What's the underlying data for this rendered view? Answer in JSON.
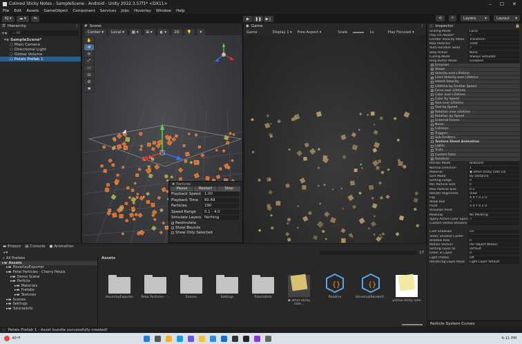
{
  "window": {
    "title": "Colored Sticky Notes - SampleScene - Android - Unity 2022.3.57f1* <DX11>",
    "min": "–",
    "max": "☐",
    "close": "✕"
  },
  "menu": [
    "File",
    "Edit",
    "Assets",
    "GameObject",
    "Component",
    "Services",
    "Jobs",
    "Hoverlay",
    "Window",
    "Help"
  ],
  "toolbar": {
    "account": "KJ ▾",
    "cloud": "☁ ▾",
    "layers": "Layers",
    "layout": "Layout"
  },
  "hierarchy": {
    "tab": "Hierarchy",
    "search_placeholder": "All",
    "items": [
      {
        "label": "SampleScene*",
        "indent": 0,
        "bold": true,
        "selected": false
      },
      {
        "label": "Main Camera",
        "indent": 1,
        "bold": false,
        "selected": false
      },
      {
        "label": "Directional Light",
        "indent": 1,
        "bold": false,
        "selected": false
      },
      {
        "label": "Global Volume",
        "indent": 1,
        "bold": false,
        "selected": false
      },
      {
        "label": "Petals Prefab 1",
        "indent": 1,
        "bold": false,
        "selected": true
      }
    ]
  },
  "scene": {
    "tab": "Scene",
    "center": "Center ▾",
    "local": "Local ▾",
    "mode2d": "2D",
    "particles": {
      "title": "Particles",
      "pause": "Pause",
      "restart": "Restart",
      "stop": "Stop",
      "rows": [
        {
          "label": "Playback Speed",
          "value": "1.00"
        },
        {
          "label": "Playback Time",
          "value": "80.69"
        },
        {
          "label": "Particles",
          "value": "190"
        },
        {
          "label": "Speed Range",
          "value": "0.1 - 4.0"
        },
        {
          "label": "Simulate Layers",
          "value": "Nothing"
        }
      ],
      "checks": [
        {
          "label": "Resimulate",
          "checked": true
        },
        {
          "label": "Show Bounds",
          "checked": false
        },
        {
          "label": "Show Only Selected",
          "checked": false
        }
      ]
    }
  },
  "game": {
    "tab": "Game",
    "mode": "Game",
    "display": "Display 1 ▾",
    "aspect": "Free Aspect ▾",
    "scale": "Scale",
    "scale_value": "1x",
    "play_focused": "Play Focused ▾"
  },
  "inspector": {
    "tab": "Inspector",
    "properties": [
      {
        "label": "Scaling Mode",
        "value": "Local"
      },
      {
        "label": "Play On Awake*",
        "value": "✓"
      },
      {
        "label": "Emitter Velocity Mode",
        "value": "Transform"
      },
      {
        "label": "Max Particles",
        "value": "1000"
      },
      {
        "label": "Auto Random Seed",
        "value": "✓"
      },
      {
        "label": "Stop Action",
        "value": "None"
      },
      {
        "label": "Culling Mode",
        "value": "Always Simulate"
      },
      {
        "label": "Ring Buffer Mode",
        "value": "Disabled"
      }
    ],
    "modules": [
      {
        "label": "Emission",
        "checked": true,
        "bold": false
      },
      {
        "label": "Shape",
        "checked": true,
        "bold": false
      },
      {
        "label": "Velocity over Lifetime",
        "checked": false,
        "bold": false
      },
      {
        "label": "Limit Velocity over Lifetime",
        "checked": true,
        "bold": false
      },
      {
        "label": "Inherit Velocity",
        "checked": false,
        "bold": false
      },
      {
        "label": "Lifetime by Emitter Speed",
        "checked": false,
        "bold": false
      },
      {
        "label": "Force over Lifetime",
        "checked": true,
        "bold": false
      },
      {
        "label": "Color over Lifetime",
        "checked": false,
        "bold": false
      },
      {
        "label": "Color by Speed",
        "checked": false,
        "bold": false
      },
      {
        "label": "Size over Lifetime",
        "checked": true,
        "bold": false
      },
      {
        "label": "Size by Speed",
        "checked": false,
        "bold": false
      },
      {
        "label": "Rotation over Lifetime",
        "checked": true,
        "bold": false
      },
      {
        "label": "Rotation by Speed",
        "checked": false,
        "bold": false
      },
      {
        "label": "External Forces",
        "checked": false,
        "bold": false
      },
      {
        "label": "Noise",
        "checked": false,
        "bold": false
      },
      {
        "label": "Collision",
        "checked": false,
        "bold": false
      },
      {
        "label": "Triggers",
        "checked": false,
        "bold": false
      },
      {
        "label": "Sub Emitters",
        "checked": false,
        "bold": false
      },
      {
        "label": "Texture Sheet Animation",
        "checked": false,
        "bold": true
      },
      {
        "label": "Lights",
        "checked": false,
        "bold": false
      },
      {
        "label": "Trails",
        "checked": false,
        "bold": false
      },
      {
        "label": "Custom Data",
        "checked": false,
        "bold": false
      },
      {
        "label": "Renderer",
        "checked": true,
        "bold": false
      }
    ],
    "renderer": [
      {
        "label": "Render Mode",
        "value": "Billboard"
      },
      {
        "label": "Normal Direction",
        "value": "1"
      },
      {
        "label": "Material",
        "value": "◉ other sticky note col"
      },
      {
        "label": "Sort Mode",
        "value": "By Distance"
      },
      {
        "label": "Sorting Fudge",
        "value": "0"
      },
      {
        "label": "Min Particle Size",
        "value": "0"
      },
      {
        "label": "Max Particle Size",
        "value": "0.5"
      },
      {
        "label": "Render Alignment",
        "value": "View"
      },
      {
        "label": "Flip",
        "value": "X 0   Y 0   Z 0"
      },
      {
        "label": "Allow Roll",
        "value": "✓"
      },
      {
        "label": "Pivot",
        "value": "X 0   Y 0   Z 0"
      },
      {
        "label": "Visualize Pivot",
        "value": ""
      },
      {
        "label": "Masking",
        "value": "No Masking"
      },
      {
        "label": "Apply Active Color Space",
        "value": "✓"
      },
      {
        "label": "Custom Vertex Streams",
        "value": ""
      },
      {
        "label": "",
        "value": ""
      },
      {
        "label": "Cast Shadows",
        "value": "On"
      },
      {
        "label": "Static Shadow Caster",
        "value": ""
      },
      {
        "label": "Shadow Bias",
        "value": "0"
      },
      {
        "label": "Motion Vectors",
        "value": "Per Object Motion"
      },
      {
        "label": "Sorting Layer ID",
        "value": "Default"
      },
      {
        "label": "Order in Layer",
        "value": "0"
      },
      {
        "label": "Light Probes",
        "value": "Off"
      },
      {
        "label": "Rendering Layer Mask",
        "value": "Light Layer default"
      }
    ],
    "curves": "Particle System Curves"
  },
  "project": {
    "tabs": [
      "Project",
      "Console",
      "Animation"
    ],
    "all_prefabs": "All Prefabs",
    "breadcrumb": "Assets",
    "count": "17",
    "tree": [
      {
        "label": "Assets",
        "indent": 0,
        "bold": true
      },
      {
        "label": "HoverlayExporter",
        "indent": 1,
        "bold": false
      },
      {
        "label": "Petal Particles - Cherry Petals",
        "indent": 1,
        "bold": false
      },
      {
        "label": "Demo Scene",
        "indent": 2,
        "bold": false
      },
      {
        "label": "Particle",
        "indent": 2,
        "bold": false
      },
      {
        "label": "Materials",
        "indent": 3,
        "bold": false
      },
      {
        "label": "Prefabs",
        "indent": 3,
        "bold": false
      },
      {
        "label": "Textures",
        "indent": 3,
        "bold": false
      },
      {
        "label": "Scenes",
        "indent": 1,
        "bold": false
      },
      {
        "label": "Settings",
        "indent": 1,
        "bold": false
      },
      {
        "label": "TutorialInfo",
        "indent": 1,
        "bold": false
      }
    ],
    "assets": [
      {
        "label": "HoverlayExporter",
        "kind": "folder"
      },
      {
        "label": "Petal Particles - ...",
        "kind": "folder"
      },
      {
        "label": "Scenes",
        "kind": "folder"
      },
      {
        "label": "Settings",
        "kind": "folder"
      },
      {
        "label": "TutorialInfo",
        "kind": "folder"
      },
      {
        "label": "◉ other sticky note...",
        "kind": "note"
      },
      {
        "label": "Readme",
        "kind": "script"
      },
      {
        "label": "UniversalRenderP...",
        "kind": "script"
      },
      {
        "label": "yellow sticky note",
        "kind": "note-light"
      }
    ]
  },
  "status": {
    "message": "Petals Prefab 1 - Asset bundle successfully created!"
  },
  "taskbar": {
    "weather_temp": "40°F",
    "time": "4:11 PM"
  }
}
